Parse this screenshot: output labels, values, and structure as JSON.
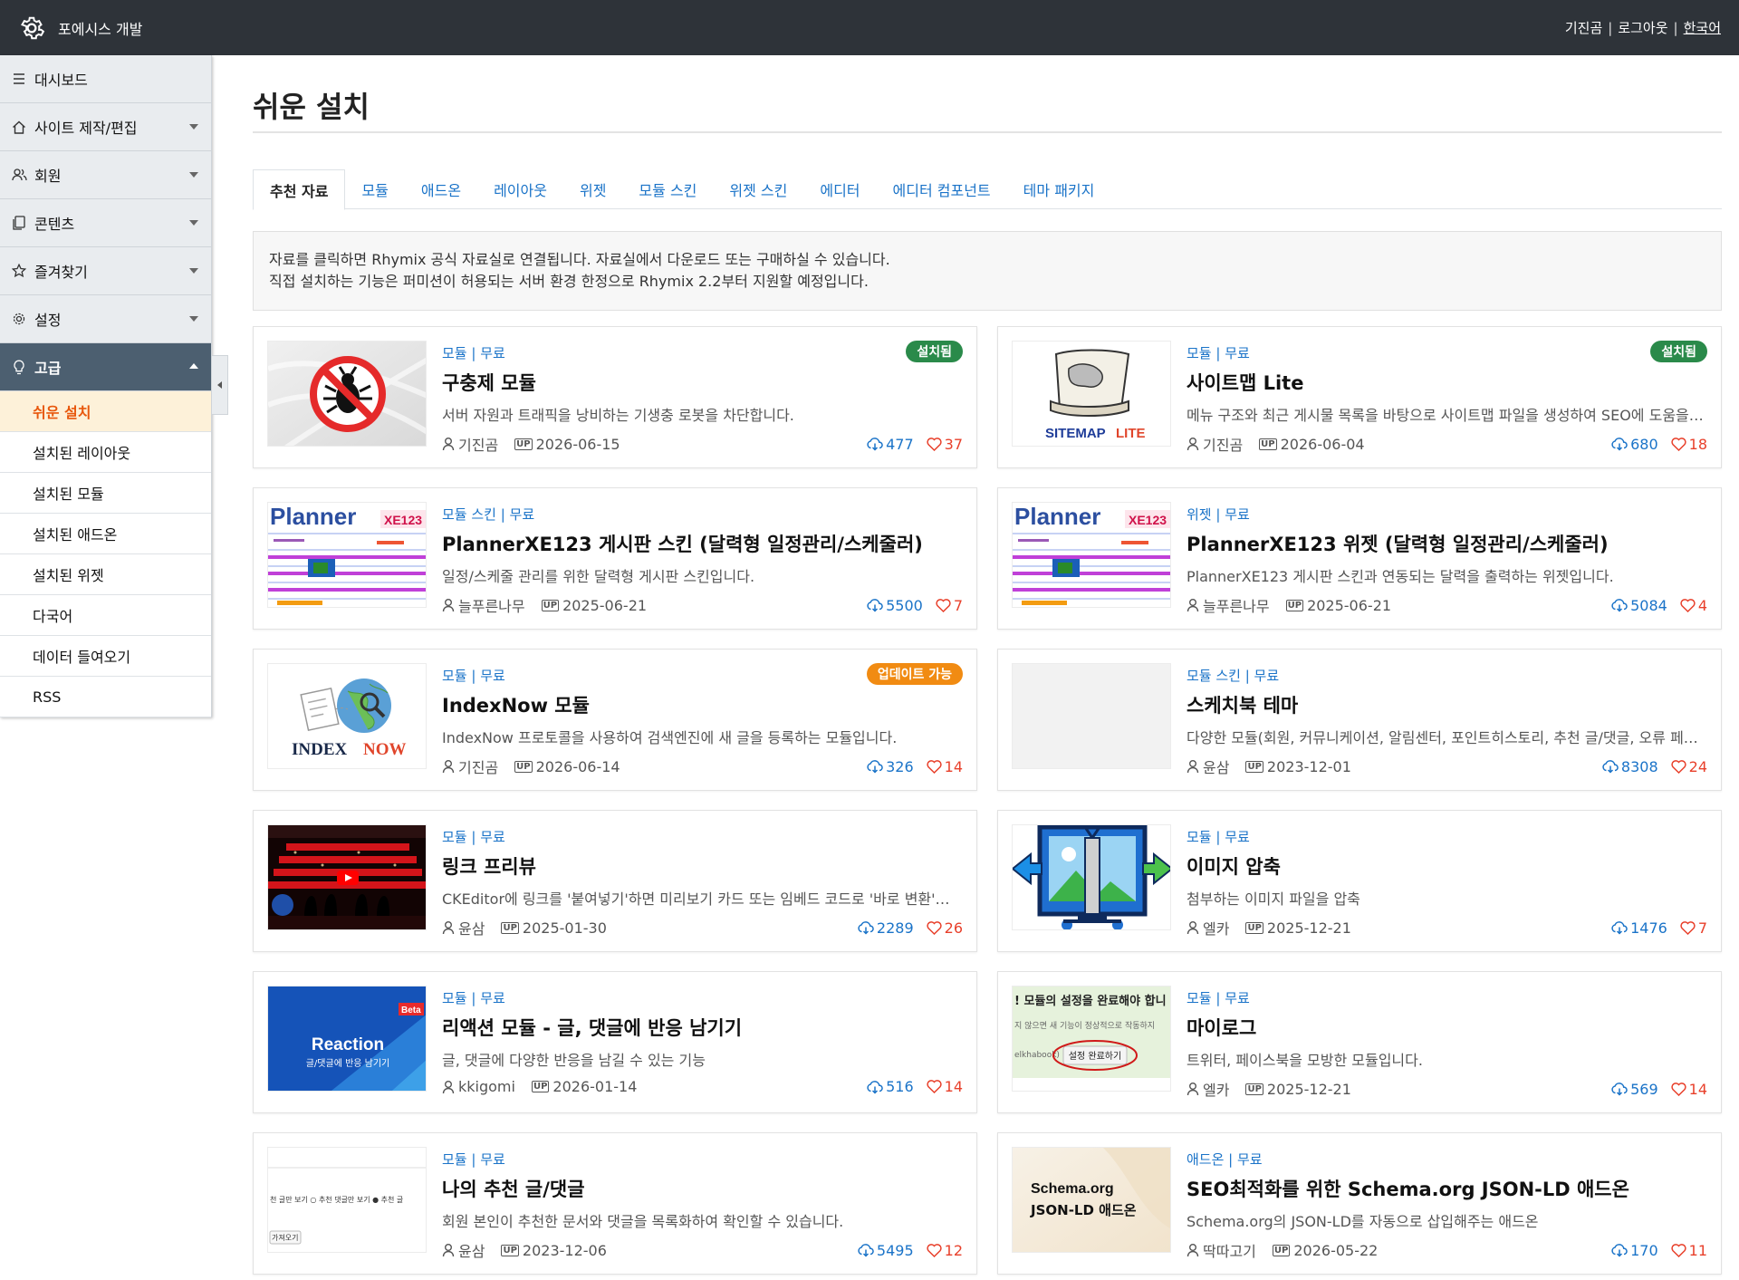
{
  "topbar": {
    "site_title": "포에시스 개발",
    "user": "기진곰",
    "logout": "로그아웃",
    "language": "한국어"
  },
  "sidebar": {
    "items": [
      {
        "label": "대시보드",
        "icon": "menu-icon"
      },
      {
        "label": "사이트 제작/편집",
        "icon": "home-icon"
      },
      {
        "label": "회원",
        "icon": "users-icon"
      },
      {
        "label": "콘텐츠",
        "icon": "document-icon"
      },
      {
        "label": "즐겨찾기",
        "icon": "star-icon"
      },
      {
        "label": "설정",
        "icon": "gear-icon"
      },
      {
        "label": "고급",
        "icon": "lightbulb-icon"
      }
    ],
    "sub_items": [
      "쉬운 설치",
      "설치된 레이아웃",
      "설치된 모듈",
      "설치된 애드온",
      "설치된 위젯",
      "다국어",
      "데이터 들여오기",
      "RSS"
    ]
  },
  "main": {
    "title": "쉬운 설치",
    "tabs": [
      "추천 자료",
      "모듈",
      "애드온",
      "레이아웃",
      "위젯",
      "모듈 스킨",
      "위젯 스킨",
      "에디터",
      "에디터 컴포넌트",
      "테마 패키지"
    ],
    "notice_line1": "자료를 클릭하면 Rhymix 공식 자료실로 연결됩니다. 자료실에서 다운로드 또는 구매하실 수 있습니다.",
    "notice_line2": "직접 설치하는 기능은 퍼미션이 허용되는 서버 환경 한정으로 Rhymix 2.2부터 지원할 예정입니다.",
    "items": [
      {
        "category": "모듈 | 무료",
        "name": "구충제 모듈",
        "description": "서버 자원과 트래픽을 낭비하는 기생충 로봇을 차단합니다.",
        "author": "기진곰",
        "date": "2026-06-15",
        "downloads": "477",
        "likes": "37",
        "badge": "설치됨",
        "thumb_text": ""
      },
      {
        "category": "모듈 | 무료",
        "name": "사이트맵 Lite",
        "description": "메뉴 구조와 최근 게시물 목록을 바탕으로 사이트맵 파일을 생성하여 SEO에 도움을 줍니다.",
        "author": "기진곰",
        "date": "2026-06-04",
        "downloads": "680",
        "likes": "18",
        "badge": "설치됨",
        "thumb_text": "SITEMAPLITE"
      },
      {
        "category": "모듈 스킨 | 무료",
        "name": "PlannerXE123 게시판 스킨 (달력형 일정관리/스케줄러)",
        "description": "일정/스케줄 관리를 위한 달력형 게시판 스킨입니다.",
        "author": "늘푸른나무",
        "date": "2025-06-21",
        "downloads": "5500",
        "likes": "7",
        "badge": "",
        "thumb_text": "Planner"
      },
      {
        "category": "위젯 | 무료",
        "name": "PlannerXE123 위젯 (달력형 일정관리/스케줄러)",
        "description": "PlannerXE123 게시판 스킨과 연동되는 달력을 출력하는 위젯입니다.",
        "author": "늘푸른나무",
        "date": "2025-06-21",
        "downloads": "5084",
        "likes": "4",
        "badge": "",
        "thumb_text": "Planner"
      },
      {
        "category": "모듈 | 무료",
        "name": "IndexNow 모듈",
        "description": "IndexNow 프로토콜을 사용하여 검색엔진에 새 글을 등록하는 모듈입니다.",
        "author": "기진곰",
        "date": "2026-06-14",
        "downloads": "326",
        "likes": "14",
        "badge": "업데이트 가능",
        "thumb_text": "INDEXNOW"
      },
      {
        "category": "모듈 스킨 | 무료",
        "name": "스케치북 테마",
        "description": "다양한 모듈(회원, 커뮤니케이션, 알림센터, 포인트히스토리, 추천 글/댓글, 오류 페이지 등) 스킨",
        "author": "윤삼",
        "date": "2023-12-01",
        "downloads": "8308",
        "likes": "24",
        "badge": "",
        "thumb_text": ""
      },
      {
        "category": "모듈 | 무료",
        "name": "링크 프리뷰",
        "description": "CKEditor에 링크를 '붙여넣기'하면 미리보기 카드 또는 임베드 코드로 '바로 변환'해줍니다.",
        "author": "윤삼",
        "date": "2025-01-30",
        "downloads": "2289",
        "likes": "26",
        "badge": "",
        "thumb_text": ""
      },
      {
        "category": "모듈 | 무료",
        "name": "이미지 압축",
        "description": "첨부하는 이미지 파일을 압축",
        "author": "엘카",
        "date": "2025-12-21",
        "downloads": "1476",
        "likes": "7",
        "badge": "",
        "thumb_text": ""
      },
      {
        "category": "모듈 | 무료",
        "name": "리액션 모듈 - 글, 댓글에 반응 남기기",
        "description": "글, 댓글에 다양한 반응을 남길 수 있는 기능",
        "author": "kkigomi",
        "date": "2026-01-14",
        "downloads": "516",
        "likes": "14",
        "badge": "",
        "thumb_text": "Reaction"
      },
      {
        "category": "모듈 | 무료",
        "name": "마이로그",
        "description": "트위터, 페이스북을 모방한 모듈입니다.",
        "author": "엘카",
        "date": "2025-12-21",
        "downloads": "569",
        "likes": "14",
        "badge": "",
        "thumb_text": "설정 완료하기"
      },
      {
        "category": "모듈 | 무료",
        "name": "나의 추천 글/댓글",
        "description": "회원 본인이 추천한 문서와 댓글을 목록화하여 확인할 수 있습니다.",
        "author": "윤삼",
        "date": "2023-12-06",
        "downloads": "5495",
        "likes": "12",
        "badge": "",
        "thumb_text": ""
      },
      {
        "category": "애드온 | 무료",
        "name": "SEO최적화를 위한 Schema.org JSON-LD 애드온",
        "description": "Schema.org의 JSON-LD를 자동으로 삽입해주는 애드온",
        "author": "딱따고기",
        "date": "2026-05-22",
        "downloads": "170",
        "likes": "11",
        "badge": "",
        "thumb_text": "Schema.org JSON-LD 애드온"
      }
    ]
  },
  "thumbs": {
    "reaction_sub": "글/댓글에 반응 남기기",
    "reaction_beta": "Beta",
    "schema_line1": "Schema.org",
    "schema_line2": "JSON-LD 애드온",
    "mylog_top": "! 모듈의 설정을 완료해야 합니",
    "mylog_mid": "지 않으면 새 기능이 정상적으로 작동하지",
    "mylog_left": "elkhabook)",
    "mylog_button": "설정 완료하기",
    "sitemap_lite": "LITE",
    "sitemap_main": "SITEMAP",
    "index_a": "INDEX",
    "index_b": "NOW",
    "planner_sub": "XE123",
    "rec_line": "천 글만 보기   ○ 추천 댓글만 보기   ● 추천 글",
    "rec_button": "가져오기"
  },
  "colors": {
    "topbar": "#2e3339",
    "accent": "#1a73c8",
    "installed": "#2a8a4a",
    "update": "#f18b12",
    "heart": "#e8402b",
    "current_sub": "#e8570c"
  }
}
